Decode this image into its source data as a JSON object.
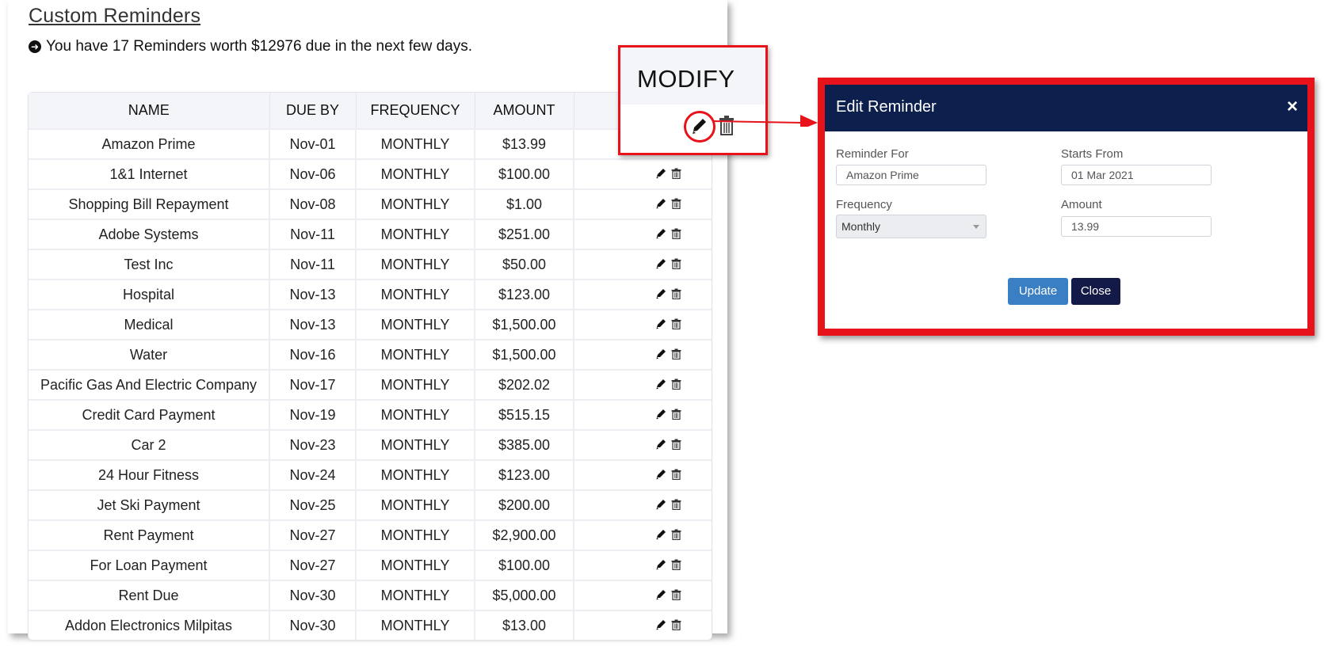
{
  "page": {
    "title": "Custom Reminders",
    "summary": "You have 17 Reminders worth $12976 due in the next few days."
  },
  "table": {
    "headers": [
      "NAME",
      "DUE BY",
      "FREQUENCY",
      "AMOUNT",
      ""
    ],
    "rows": [
      {
        "name": "Amazon Prime",
        "due": "Nov-01",
        "frequency": "MONTHLY",
        "amount": "$13.99"
      },
      {
        "name": "1&1 Internet",
        "due": "Nov-06",
        "frequency": "MONTHLY",
        "amount": "$100.00"
      },
      {
        "name": "Shopping Bill Repayment",
        "due": "Nov-08",
        "frequency": "MONTHLY",
        "amount": "$1.00"
      },
      {
        "name": "Adobe Systems",
        "due": "Nov-11",
        "frequency": "MONTHLY",
        "amount": "$251.00"
      },
      {
        "name": "Test Inc",
        "due": "Nov-11",
        "frequency": "MONTHLY",
        "amount": "$50.00"
      },
      {
        "name": "Hospital",
        "due": "Nov-13",
        "frequency": "MONTHLY",
        "amount": "$123.00"
      },
      {
        "name": "Medical",
        "due": "Nov-13",
        "frequency": "MONTHLY",
        "amount": "$1,500.00"
      },
      {
        "name": "Water",
        "due": "Nov-16",
        "frequency": "MONTHLY",
        "amount": "$1,500.00"
      },
      {
        "name": "Pacific Gas And Electric Company",
        "due": "Nov-17",
        "frequency": "MONTHLY",
        "amount": "$202.02"
      },
      {
        "name": "Credit Card Payment",
        "due": "Nov-19",
        "frequency": "MONTHLY",
        "amount": "$515.15"
      },
      {
        "name": "Car 2",
        "due": "Nov-23",
        "frequency": "MONTHLY",
        "amount": "$385.00"
      },
      {
        "name": "24 Hour Fitness",
        "due": "Nov-24",
        "frequency": "MONTHLY",
        "amount": "$123.00"
      },
      {
        "name": "Jet Ski Payment",
        "due": "Nov-25",
        "frequency": "MONTHLY",
        "amount": "$200.00"
      },
      {
        "name": "Rent Payment",
        "due": "Nov-27",
        "frequency": "MONTHLY",
        "amount": "$2,900.00"
      },
      {
        "name": "For Loan Payment",
        "due": "Nov-27",
        "frequency": "MONTHLY",
        "amount": "$100.00"
      },
      {
        "name": "Rent Due",
        "due": "Nov-30",
        "frequency": "MONTHLY",
        "amount": "$5,000.00"
      },
      {
        "name": "Addon Electronics Milpitas",
        "due": "Nov-30",
        "frequency": "MONTHLY",
        "amount": "$13.00"
      }
    ]
  },
  "callout": {
    "label": "MODIFY",
    "icons": [
      "pencil-icon",
      "trash-icon"
    ]
  },
  "dialog": {
    "title": "Edit Reminder",
    "close_glyph": "×",
    "reminder_for_label": "Reminder For",
    "reminder_for_value": "Amazon Prime",
    "starts_from_label": "Starts From",
    "starts_from_value": "01 Mar 2021",
    "frequency_label": "Frequency",
    "frequency_value": "Monthly",
    "amount_label": "Amount",
    "amount_value": "13.99",
    "update_label": "Update",
    "close_label": "Close"
  },
  "colors": {
    "highlight": "#e8121b",
    "dialog_header": "#0d1f4d",
    "update_button": "#3a7ec4",
    "close_button": "#141a47"
  }
}
